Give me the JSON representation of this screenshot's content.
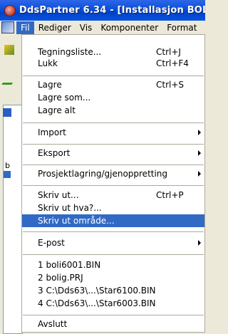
{
  "window": {
    "title": "DdsPartner 6.34 - [Installasjon BOL"
  },
  "menubar": {
    "items": [
      {
        "label": "Fil",
        "active": true
      },
      {
        "label": "Rediger"
      },
      {
        "label": "Vis"
      },
      {
        "label": "Komponenter"
      },
      {
        "label": "Format"
      }
    ]
  },
  "left_panel": {
    "b_label": "b"
  },
  "file_menu": {
    "items": [
      {
        "label": "Tegningsliste...",
        "shortcut": "Ctrl+J"
      },
      {
        "label": "Lukk",
        "shortcut": "Ctrl+F4"
      },
      {
        "label": "Lagre",
        "shortcut": "Ctrl+S"
      },
      {
        "label": "Lagre som..."
      },
      {
        "label": "Lagre alt"
      },
      {
        "label": "Import",
        "submenu": true
      },
      {
        "label": "Eksport",
        "submenu": true
      },
      {
        "label": "Prosjektlagring/gjenoppretting",
        "submenu": true
      },
      {
        "label": "Skriv ut...",
        "shortcut": "Ctrl+P"
      },
      {
        "label": "Skriv ut hva?..."
      },
      {
        "label": "Skriv ut område...",
        "highlighted": true
      },
      {
        "label": "E-post",
        "submenu": true
      },
      {
        "label": "1 boli6001.BIN"
      },
      {
        "label": "2 bolig.PRJ"
      },
      {
        "label": "3 C:\\Dds63\\...\\Star6100.BIN"
      },
      {
        "label": "4 C:\\Dds63\\...\\Star6003.BIN"
      },
      {
        "label": "Avslutt"
      }
    ]
  },
  "colors": {
    "highlight": "#316ac5",
    "titlebar": "#0a4fd8",
    "menu_bg": "#ffffff"
  }
}
